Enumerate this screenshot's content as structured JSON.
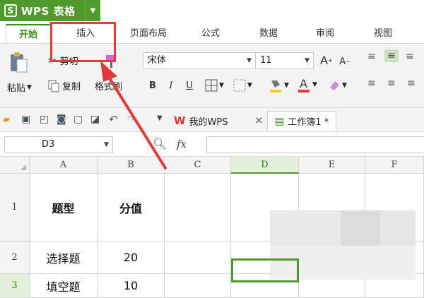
{
  "app": {
    "title": "WPS 表格",
    "logo": "S"
  },
  "ribbon_tabs": [
    "开始",
    "插入",
    "页面布局",
    "公式",
    "数据",
    "审阅",
    "视图"
  ],
  "ribbon": {
    "paste": "粘贴",
    "cut": "剪切",
    "copy": "复制",
    "format_painter": "格式刷",
    "font_name": "宋体",
    "font_size": "11",
    "bold": "B",
    "italic": "I",
    "underline": "U",
    "grow_font": "A",
    "shrink_font": "A"
  },
  "doc_tabs": {
    "my_wps": "我的WPS",
    "close": "×",
    "workbook": "工作簿1 *"
  },
  "formula_bar": {
    "cell_ref": "D3",
    "fx": "fx"
  },
  "columns": [
    "A",
    "B",
    "C",
    "D",
    "E",
    "F"
  ],
  "rows": [
    "1",
    "2",
    "3"
  ],
  "cells": {
    "A1": "题型",
    "B1": "分值",
    "A2": "选择题",
    "B2": "20",
    "A3": "填空题",
    "B3": "10"
  },
  "colors": {
    "accent_green": "#4f9a2a",
    "highlight_red": "#e23a3a"
  }
}
